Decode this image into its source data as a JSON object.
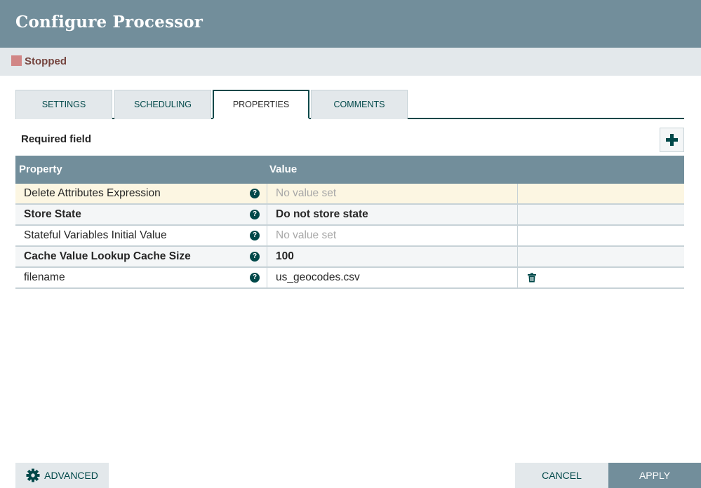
{
  "dialog": {
    "title": "Configure Processor",
    "status": "Stopped",
    "status_color": "#d18686"
  },
  "tabs": [
    {
      "label": "SETTINGS",
      "active": false
    },
    {
      "label": "SCHEDULING",
      "active": false
    },
    {
      "label": "PROPERTIES",
      "active": true
    },
    {
      "label": "COMMENTS",
      "active": false
    }
  ],
  "properties": {
    "required_label": "Required field",
    "add_icon": "plus-icon",
    "columns": {
      "property": "Property",
      "value": "Value"
    },
    "rows": [
      {
        "name": "Delete Attributes Expression",
        "value": "No value set",
        "required": false,
        "empty": true,
        "deletable": false
      },
      {
        "name": "Store State",
        "value": "Do not store state",
        "required": true,
        "empty": false,
        "deletable": false
      },
      {
        "name": "Stateful Variables Initial Value",
        "value": "No value set",
        "required": false,
        "empty": true,
        "deletable": false
      },
      {
        "name": "Cache Value Lookup Cache Size",
        "value": "100",
        "required": true,
        "empty": false,
        "deletable": false
      },
      {
        "name": "filename",
        "value": "us_geocodes.csv",
        "required": false,
        "empty": false,
        "deletable": true
      }
    ]
  },
  "footer": {
    "advanced_label": "ADVANCED",
    "advanced_icon": "gear-icon",
    "cancel_label": "CANCEL",
    "apply_label": "APPLY"
  },
  "colors": {
    "header_bg": "#728e9b",
    "accent": "#004849",
    "highlight_row": "#fcf6e2"
  }
}
